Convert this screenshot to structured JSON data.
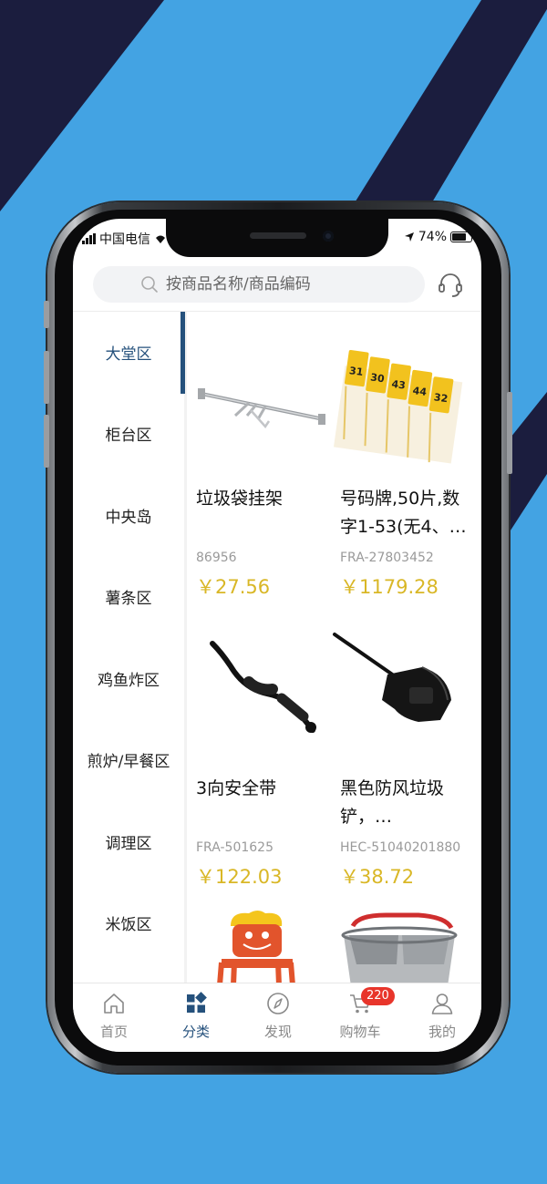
{
  "colors": {
    "background": "#43a3e3",
    "stripes": "#1b1d3e",
    "accent": "#25517c",
    "price": "#d9b726",
    "badge": "#e8352b"
  },
  "status_bar": {
    "carrier": "中国电信",
    "battery": "74%",
    "battery_level": 0.74,
    "icons": [
      "signal-icon",
      "wifi-icon",
      "location-arrow-icon",
      "battery-icon"
    ]
  },
  "search": {
    "placeholder": "按商品名称/商品编码",
    "icon": "search-icon",
    "service_icon": "headset-icon"
  },
  "sidebar": {
    "items": [
      {
        "label": "大堂区",
        "active": true
      },
      {
        "label": "柜台区"
      },
      {
        "label": "中央岛"
      },
      {
        "label": "薯条区"
      },
      {
        "label": "鸡鱼炸区"
      },
      {
        "label": "煎炉/早餐区"
      },
      {
        "label": "调理区"
      },
      {
        "label": "米饭区"
      }
    ]
  },
  "products": [
    {
      "name": "垃圾袋挂架",
      "code": "86956",
      "price": "￥27.56",
      "image": "trash-bag-rack"
    },
    {
      "name": "号码牌,50片,数字1-53(无4、…",
      "code": "FRA-27803452",
      "price": "￥1179.28",
      "image": "number-tags",
      "tag_numbers": [
        "31",
        "30",
        "43",
        "44",
        "32"
      ]
    },
    {
      "name": "3向安全带",
      "code": "FRA-501625",
      "price": "￥122.03",
      "image": "safety-belt"
    },
    {
      "name": "黑色防风垃圾铲，…",
      "code": "HEC-51040201880",
      "price": "￥38.72",
      "image": "dustpan"
    },
    {
      "image": "high-chair"
    },
    {
      "image": "mop-bucket"
    }
  ],
  "tabbar": {
    "items": [
      {
        "label": "首页",
        "icon": "home-icon"
      },
      {
        "label": "分类",
        "icon": "category-icon",
        "active": true
      },
      {
        "label": "发现",
        "icon": "compass-icon"
      },
      {
        "label": "购物车",
        "icon": "cart-icon",
        "badge": "220"
      },
      {
        "label": "我的",
        "icon": "user-icon"
      }
    ]
  }
}
